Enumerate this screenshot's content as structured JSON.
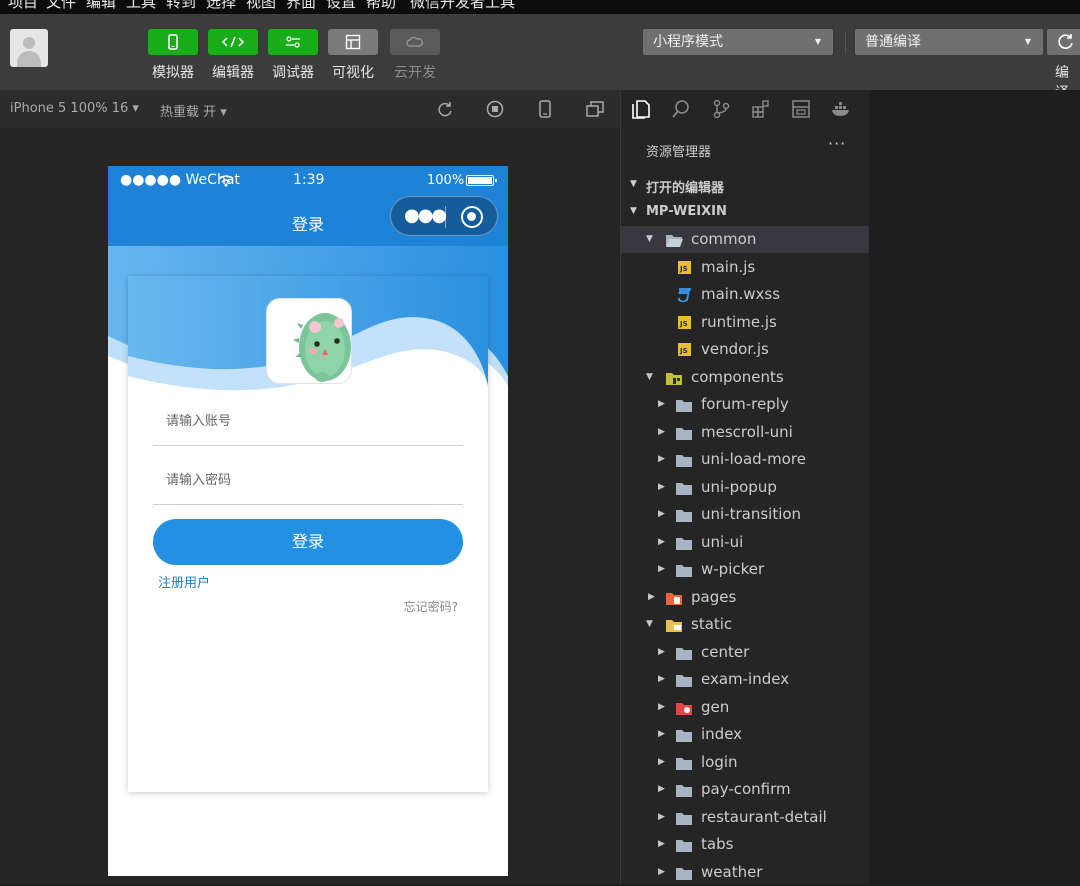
{
  "menubar": {
    "items": [
      "项目",
      "文件",
      "编辑",
      "工具",
      "转到",
      "选择",
      "视图",
      "界面",
      "设置",
      "帮助",
      "微信开发者工具"
    ]
  },
  "toolbar": {
    "tools": [
      {
        "label": "模拟器",
        "icon": "phone-icon"
      },
      {
        "label": "编辑器",
        "icon": "code-icon"
      },
      {
        "label": "调试器",
        "icon": "debug-icon"
      },
      {
        "label": "可视化",
        "icon": "layout-icon"
      },
      {
        "label": "云开发",
        "icon": "cloud-icon"
      }
    ],
    "mode_select": "小程序模式",
    "compile_select": "普通编译",
    "compile_label": "编译"
  },
  "simbar": {
    "device": "iPhone 5 100% 16 ▾",
    "hot_reload": "热重载 开 ▾"
  },
  "phone": {
    "status": {
      "carrier": "●●●●● WeChat",
      "time": "1:39",
      "battery": "100%"
    },
    "nav_title": "登录",
    "account_placeholder": "请输入账号",
    "password_placeholder": "请输入密码",
    "login_button": "登录",
    "register_link": "注册用户",
    "forgot_link": "忘记密码?"
  },
  "explorer": {
    "title": "资源管理器",
    "more": "···",
    "open_editors": "打开的编辑器",
    "project": "MP-WEIXIN",
    "tree": [
      {
        "name": "common",
        "type": "folder-open",
        "level": 1,
        "expanded": true,
        "selected": true
      },
      {
        "name": "main.js",
        "type": "js",
        "level": 2
      },
      {
        "name": "main.wxss",
        "type": "css",
        "level": 2
      },
      {
        "name": "runtime.js",
        "type": "js",
        "level": 2
      },
      {
        "name": "vendor.js",
        "type": "js",
        "level": 2
      },
      {
        "name": "components",
        "type": "folder-components",
        "level": 1,
        "expanded": true
      },
      {
        "name": "forum-reply",
        "type": "folder",
        "level": 2
      },
      {
        "name": "mescroll-uni",
        "type": "folder",
        "level": 2
      },
      {
        "name": "uni-load-more",
        "type": "folder",
        "level": 2
      },
      {
        "name": "uni-popup",
        "type": "folder",
        "level": 2
      },
      {
        "name": "uni-transition",
        "type": "folder",
        "level": 2
      },
      {
        "name": "uni-ui",
        "type": "folder",
        "level": 2
      },
      {
        "name": "w-picker",
        "type": "folder",
        "level": 2
      },
      {
        "name": "pages",
        "type": "folder-pages",
        "level": 1
      },
      {
        "name": "static",
        "type": "folder-static",
        "level": 1,
        "expanded": true
      },
      {
        "name": "center",
        "type": "folder",
        "level": 2
      },
      {
        "name": "exam-index",
        "type": "folder",
        "level": 2
      },
      {
        "name": "gen",
        "type": "folder-gen",
        "level": 2
      },
      {
        "name": "index",
        "type": "folder",
        "level": 2
      },
      {
        "name": "login",
        "type": "folder",
        "level": 2
      },
      {
        "name": "pay-confirm",
        "type": "folder",
        "level": 2
      },
      {
        "name": "restaurant-detail",
        "type": "folder",
        "level": 2
      },
      {
        "name": "tabs",
        "type": "folder",
        "level": 2
      },
      {
        "name": "weather",
        "type": "folder",
        "level": 2
      }
    ]
  },
  "colors": {
    "accent_green": "#1aad19",
    "nav_blue": "#1e82d6",
    "button_blue": "#2390e2",
    "link_blue": "#1f7fd3"
  }
}
